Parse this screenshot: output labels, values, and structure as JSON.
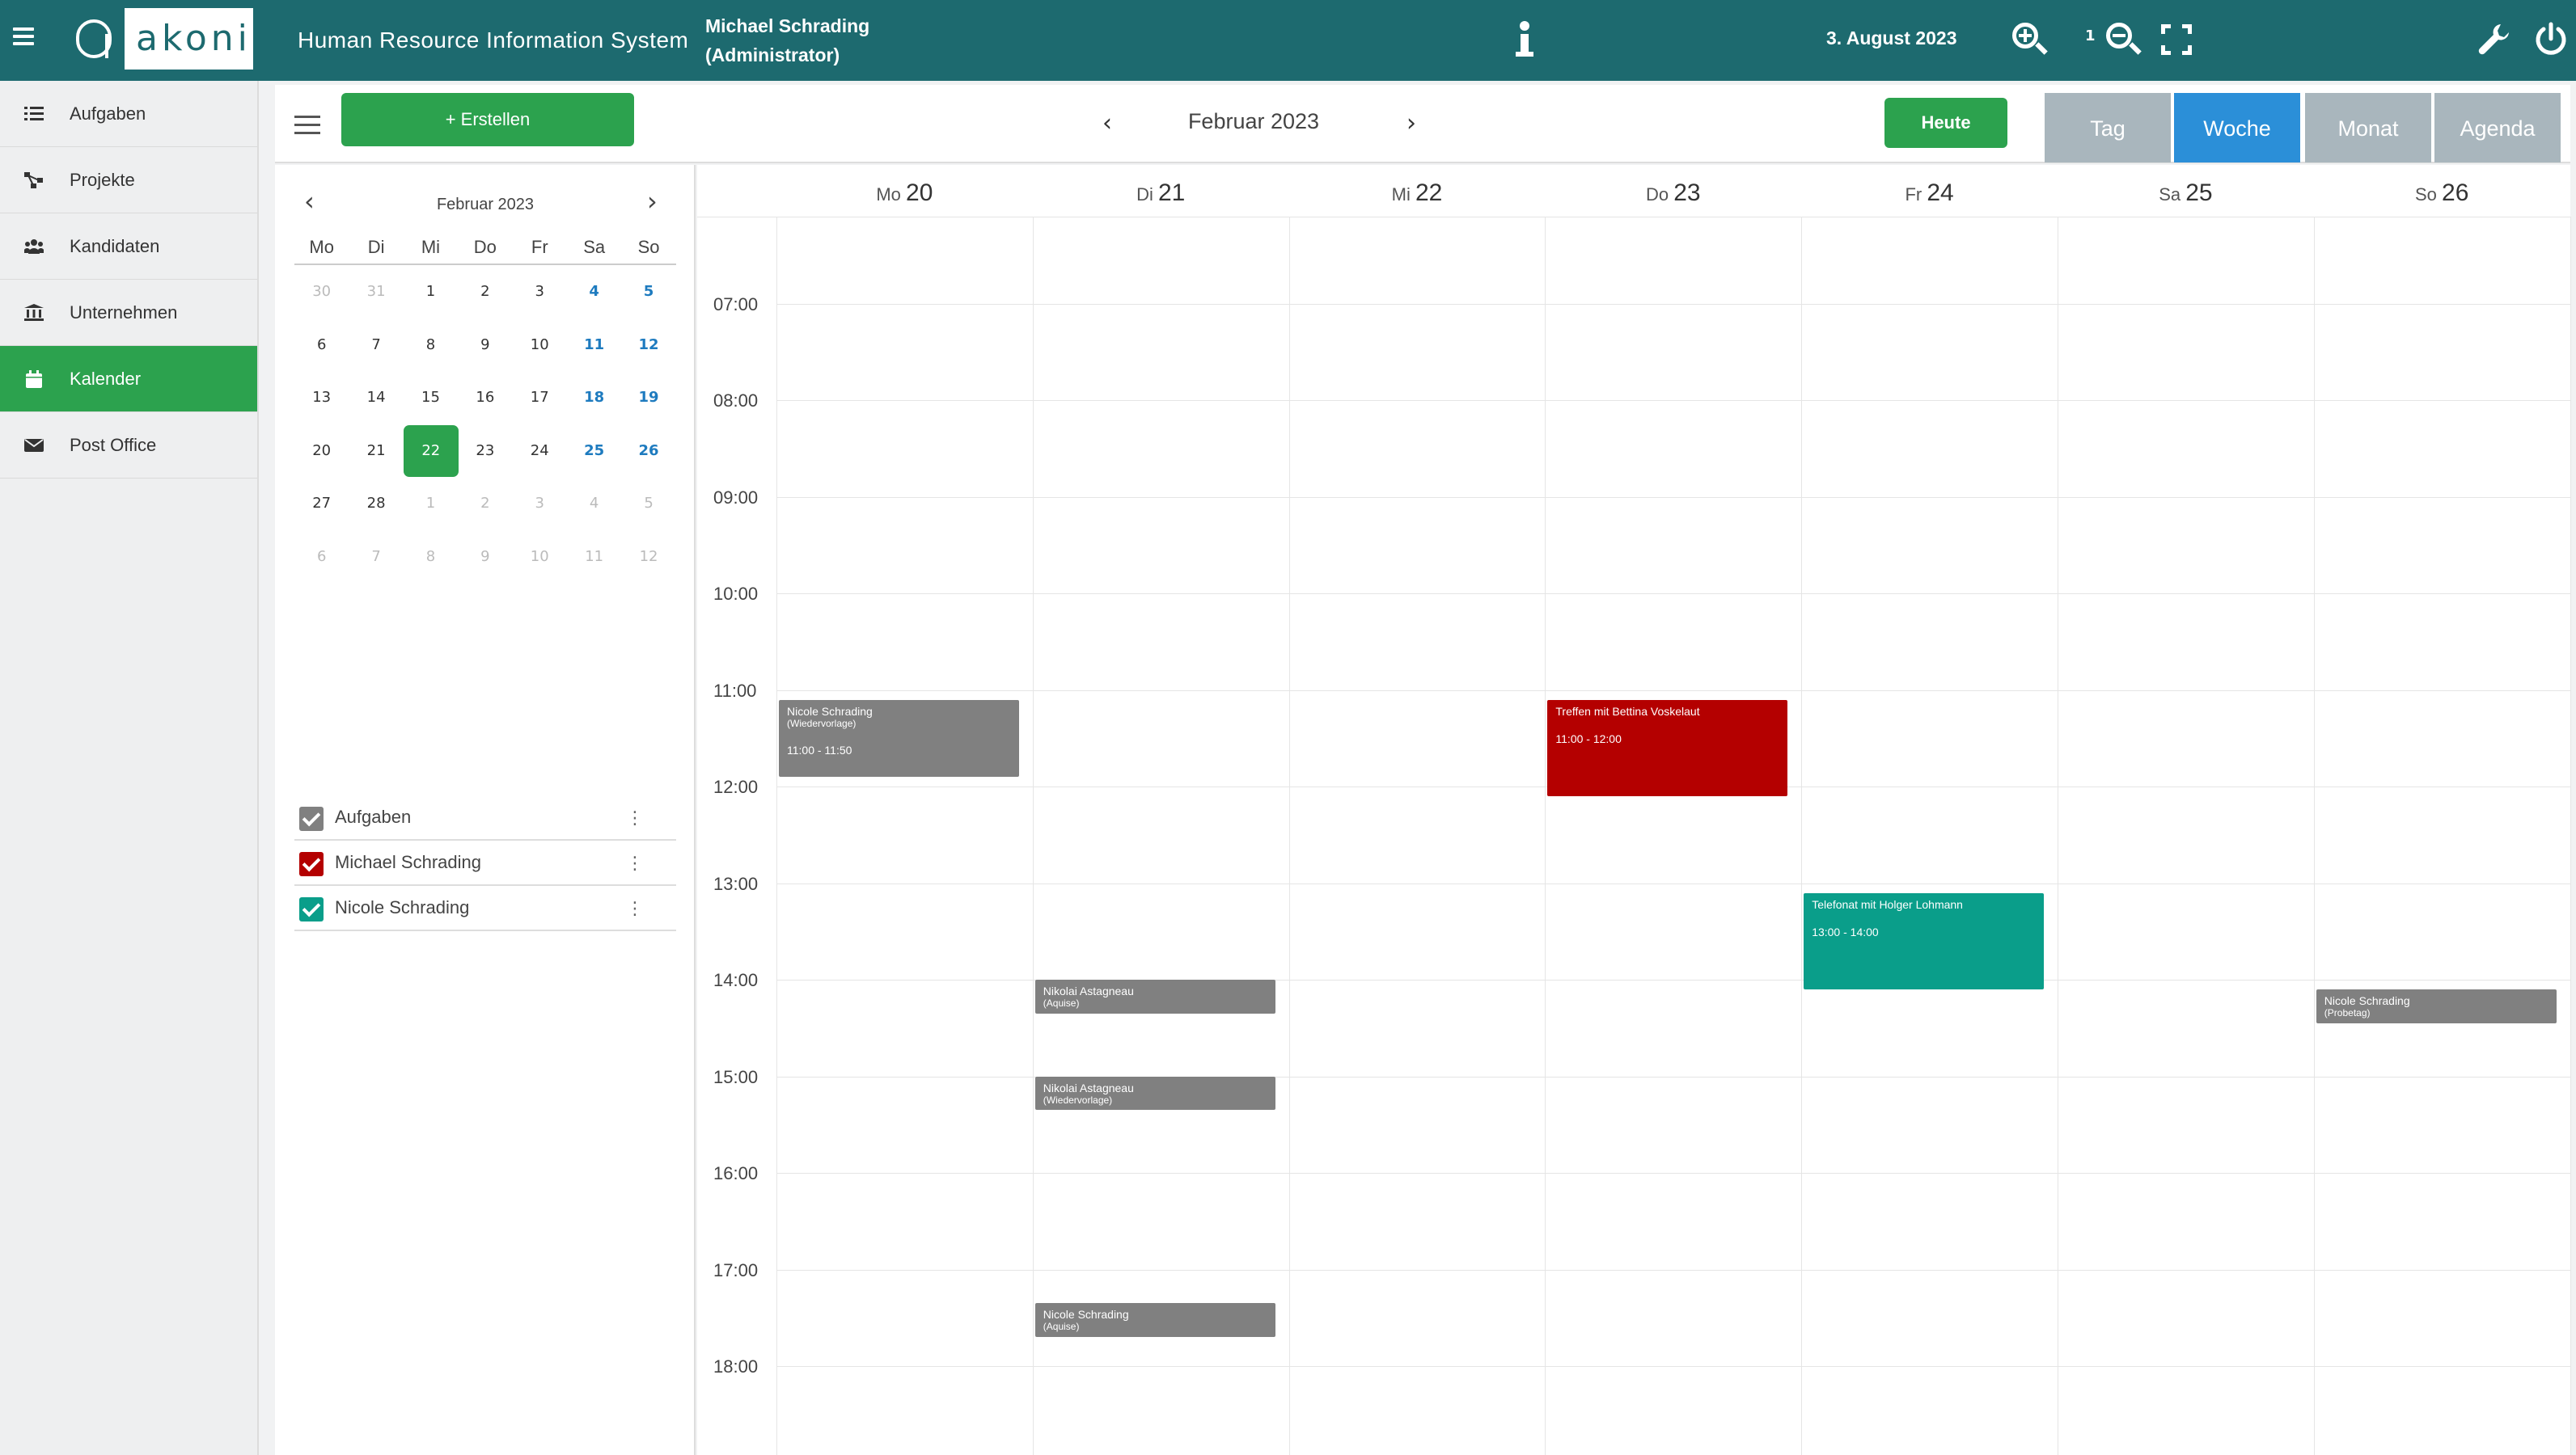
{
  "header": {
    "brand": "akoni",
    "system_name": "Human Resource Information System",
    "user_name": "Michael Schrading",
    "user_role": "(Administrator)",
    "current_date": "3. August 2023",
    "zoom_level": "1",
    "icons": [
      "menu-icon",
      "info-icon",
      "zoom-in-icon",
      "zoom-out-icon",
      "fullscreen-icon",
      "wrench-icon",
      "power-icon"
    ]
  },
  "sidebar": {
    "items": [
      {
        "label": "Aufgaben",
        "icon": "tasks-icon"
      },
      {
        "label": "Projekte",
        "icon": "project-icon"
      },
      {
        "label": "Kandidaten",
        "icon": "users-icon"
      },
      {
        "label": "Unternehmen",
        "icon": "bank-icon"
      },
      {
        "label": "Kalender",
        "icon": "calendar-icon",
        "active": true
      },
      {
        "label": "Post Office",
        "icon": "envelope-icon"
      }
    ]
  },
  "toolbar": {
    "create_label": "+  Erstellen",
    "month_title": "Februar 2023",
    "prev": "‹",
    "next": "›",
    "today_label": "Heute",
    "views": [
      "Tag",
      "Woche",
      "Monat",
      "Agenda"
    ],
    "active_view": "Woche"
  },
  "mini_calendar": {
    "title": "Februar 2023",
    "prev": "‹",
    "next": "›",
    "weekdays": [
      "Mo",
      "Di",
      "Mi",
      "Do",
      "Fr",
      "Sa",
      "So"
    ],
    "weeks": [
      [
        "30",
        "31",
        "1",
        "2",
        "3",
        "4",
        "5"
      ],
      [
        "6",
        "7",
        "8",
        "9",
        "10",
        "11",
        "12"
      ],
      [
        "13",
        "14",
        "15",
        "16",
        "17",
        "18",
        "19"
      ],
      [
        "20",
        "21",
        "22",
        "23",
        "24",
        "25",
        "26"
      ],
      [
        "27",
        "28",
        "1",
        "2",
        "3",
        "4",
        "5"
      ],
      [
        "6",
        "7",
        "8",
        "9",
        "10",
        "11",
        "12"
      ]
    ],
    "selected": "22"
  },
  "calendars": [
    {
      "label": "Aufgaben",
      "color": "#808080"
    },
    {
      "label": "Michael Schrading",
      "color": "#b40000"
    },
    {
      "label": "Nicole Schrading",
      "color": "#0a9e8a"
    }
  ],
  "week": {
    "days": [
      {
        "name": "Mo",
        "date": "20"
      },
      {
        "name": "Di",
        "date": "21"
      },
      {
        "name": "Mi",
        "date": "22"
      },
      {
        "name": "Do",
        "date": "23"
      },
      {
        "name": "Fr",
        "date": "24"
      },
      {
        "name": "Sa",
        "date": "25"
      },
      {
        "name": "So",
        "date": "26"
      }
    ],
    "hours": [
      "07:00",
      "08:00",
      "09:00",
      "10:00",
      "11:00",
      "12:00",
      "13:00",
      "14:00",
      "15:00",
      "16:00",
      "17:00",
      "18:00"
    ]
  },
  "events": [
    {
      "title": "Nicole Schrading",
      "sub": "(Wiedervorlage)",
      "time": "11:00 - 11:50",
      "day": 0,
      "start": 11.1,
      "end": 11.9,
      "color": "#808080"
    },
    {
      "title": "Treffen mit Bettina Voskelaut",
      "sub": "",
      "time": "11:00 - 12:00",
      "day": 3,
      "start": 11.1,
      "end": 12.1,
      "color": "#b40000"
    },
    {
      "title": "Telefonat mit Holger Lohmann",
      "sub": "",
      "time": "13:00 - 14:00",
      "day": 4,
      "start": 13.1,
      "end": 14.1,
      "color": "#0a9e8a"
    },
    {
      "title": "Nikolai Astagneau",
      "sub": "(Aquise)",
      "time": "",
      "day": 1,
      "start": 14.0,
      "end": 14.35,
      "color": "#808080"
    },
    {
      "title": "Nikolai Astagneau",
      "sub": "(Wiedervorlage)",
      "time": "",
      "day": 1,
      "start": 15.0,
      "end": 15.35,
      "color": "#808080"
    },
    {
      "title": "Nicole Schrading",
      "sub": "(Probetag)",
      "time": "",
      "day": 6,
      "start": 14.1,
      "end": 14.45,
      "color": "#808080"
    },
    {
      "title": "Nicole Schrading",
      "sub": "(Aquise)",
      "time": "",
      "day": 1,
      "start": 17.35,
      "end": 17.7,
      "color": "#808080"
    }
  ]
}
